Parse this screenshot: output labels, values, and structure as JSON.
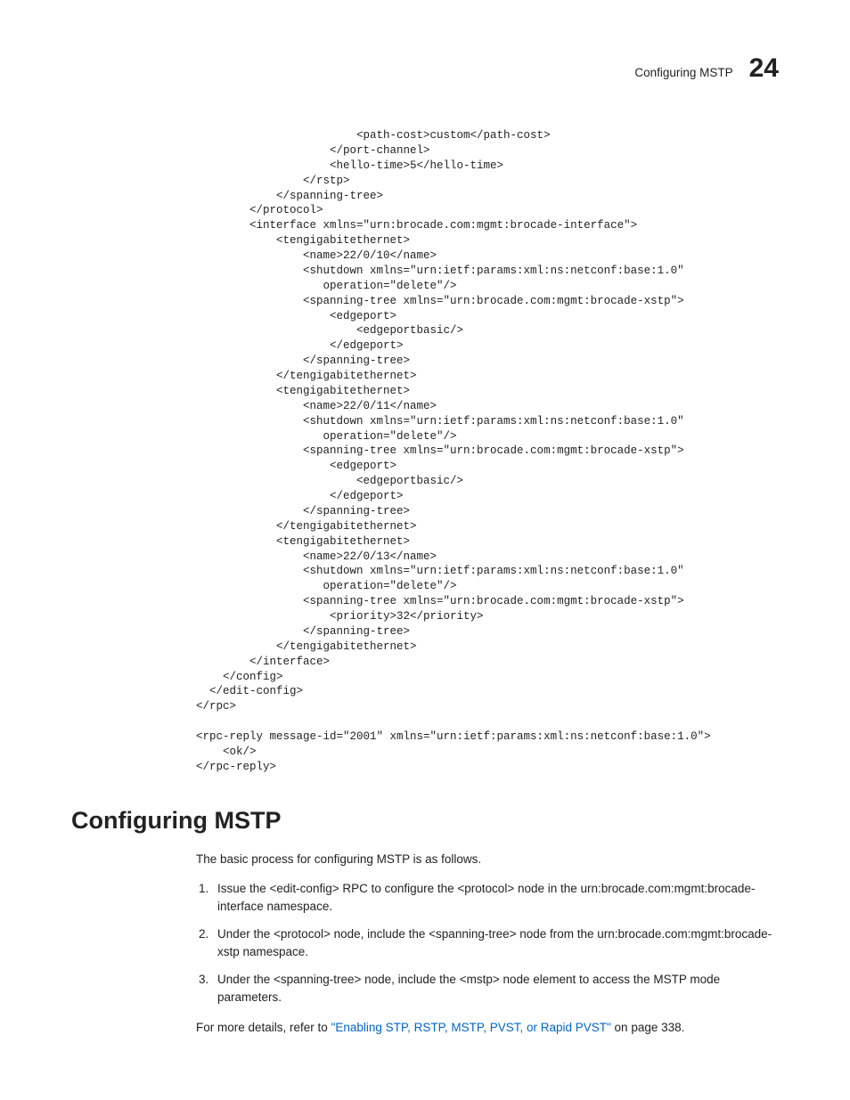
{
  "header": {
    "title": "Configuring MSTP",
    "chapter": "24"
  },
  "codeBlock": "                        <path-cost>custom</path-cost>\n                    </port-channel>\n                    <hello-time>5</hello-time>\n                </rstp>\n            </spanning-tree>\n        </protocol>\n        <interface xmlns=\"urn:brocade.com:mgmt:brocade-interface\">\n            <tengigabitethernet>\n                <name>22/0/10</name>\n                <shutdown xmlns=\"urn:ietf:params:xml:ns:netconf:base:1.0\"\n                   operation=\"delete\"/>\n                <spanning-tree xmlns=\"urn:brocade.com:mgmt:brocade-xstp\">\n                    <edgeport>\n                        <edgeportbasic/>\n                    </edgeport>\n                </spanning-tree>\n            </tengigabitethernet>\n            <tengigabitethernet>\n                <name>22/0/11</name>\n                <shutdown xmlns=\"urn:ietf:params:xml:ns:netconf:base:1.0\"\n                   operation=\"delete\"/>\n                <spanning-tree xmlns=\"urn:brocade.com:mgmt:brocade-xstp\">\n                    <edgeport>\n                        <edgeportbasic/>\n                    </edgeport>\n                </spanning-tree>\n            </tengigabitethernet>\n            <tengigabitethernet>\n                <name>22/0/13</name>\n                <shutdown xmlns=\"urn:ietf:params:xml:ns:netconf:base:1.0\"\n                   operation=\"delete\"/>\n                <spanning-tree xmlns=\"urn:brocade.com:mgmt:brocade-xstp\">\n                    <priority>32</priority>\n                </spanning-tree>\n            </tengigabitethernet>\n        </interface>\n    </config>\n  </edit-config>\n</rpc>\n\n<rpc-reply message-id=\"2001\" xmlns=\"urn:ietf:params:xml:ns:netconf:base:1.0\">\n    <ok/>\n</rpc-reply>",
  "section": {
    "heading": "Configuring MSTP",
    "intro": "The basic process for configuring MSTP is as follows.",
    "steps": [
      "Issue the <edit-config> RPC to configure the <protocol> node in the urn:brocade.com:mgmt:brocade-interface namespace.",
      "Under the <protocol> node, include the <spanning-tree> node from the urn:brocade.com:mgmt:brocade-xstp namespace.",
      "Under the <spanning-tree> node, include the <mstp> node element to access the MSTP mode parameters."
    ],
    "refer_prefix": "For more details, refer to ",
    "refer_link": "\"Enabling STP, RSTP, MSTP, PVST, or Rapid PVST\"",
    "refer_suffix": " on page 338."
  }
}
